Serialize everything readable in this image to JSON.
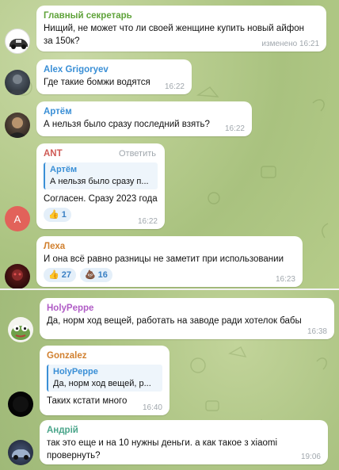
{
  "colors": {
    "name_green": "#5fa33a",
    "name_blue": "#3a8fd6",
    "name_orange": "#d1802f",
    "name_red": "#cf5b56",
    "name_purple": "#b05cc6",
    "name_teal": "#4aa58a",
    "link_blue": "#3a8fd6",
    "time_gray": "#a0a7ad",
    "reaction_bg": "#e4eff9",
    "reaction_text": "#3a80c4",
    "avatar_ant_bg": "#e2625a"
  },
  "messages": [
    {
      "name": "Главный секретарь",
      "text_lines": [
        "Нищий, не может что ли своей женщине купить новый айфон",
        "за 150к?"
      ],
      "time": "изменено 16:21",
      "avatar_icon": "car-avatar-icon"
    },
    {
      "name": "Alex Grigoryev",
      "text": "Где такие бомжи водятся",
      "time": "16:22",
      "avatar_icon": "photo-avatar-icon"
    },
    {
      "name": "Артём",
      "text": "А нельзя было сразу  последний взять?",
      "time": "16:22",
      "avatar_icon": "photo-avatar-icon"
    },
    {
      "name": "ANT",
      "reply_label": "Ответить",
      "quote_name": "Артём",
      "quote_text": "А нельзя было сразу  п...",
      "text": "Согласен. Сразу 2023 года",
      "reactions": [
        {
          "emoji": "👍",
          "count": "1"
        }
      ],
      "time": "16:22",
      "avatar_letter": "A"
    },
    {
      "name": "Леха",
      "text": "И она всё равно разницы не заметит при использовании",
      "reactions": [
        {
          "emoji": "👍",
          "count": "27"
        },
        {
          "emoji": "💩",
          "count": "16"
        }
      ],
      "time": "16:23",
      "avatar_icon": "photo-avatar-icon"
    },
    {
      "name": "HolyPeppe",
      "text": "Да, норм ход вещей, работать на заводе ради хотелок бабы",
      "time": "16:38",
      "avatar_icon": "frog-avatar-icon"
    },
    {
      "name": "Gonzalez",
      "quote_name": "HolyPeppe",
      "quote_text": "Да, норм ход вещей, р...",
      "text": "Таких кстати много",
      "time": "16:40",
      "avatar_icon": "photo-avatar-icon"
    },
    {
      "name": "Андрій",
      "text_lines": [
        "так это еще и на 10 нужны деньги. а как такое з xiaomi",
        "провернуть?"
      ],
      "time": "19:06",
      "avatar_icon": "car-avatar-icon"
    }
  ]
}
